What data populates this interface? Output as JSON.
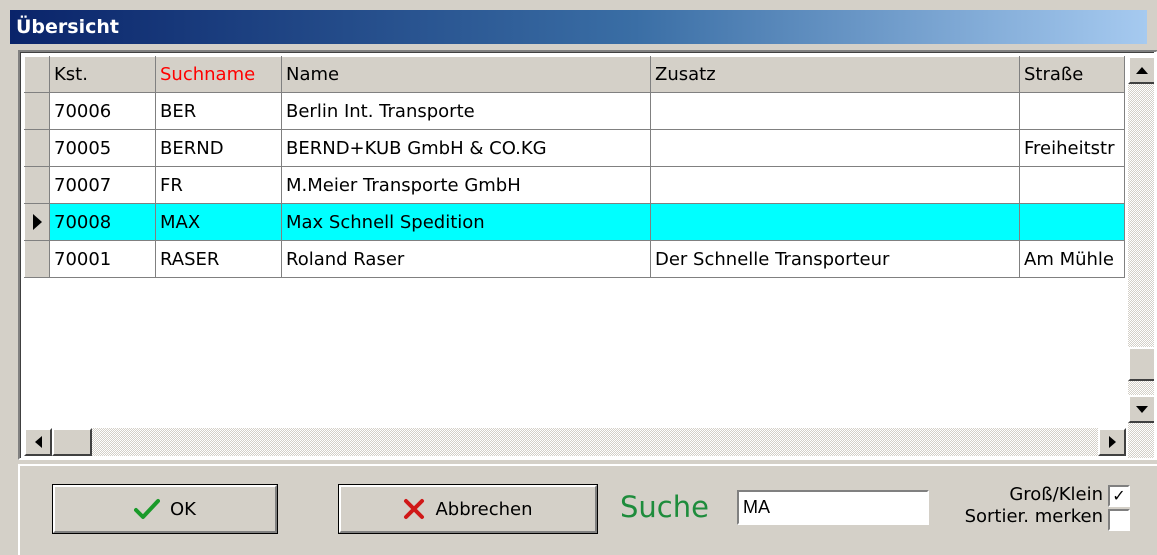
{
  "window": {
    "title": "Übersicht"
  },
  "grid": {
    "columns": [
      "Kst.",
      "Suchname",
      "Name",
      "Zusatz",
      "Straße"
    ],
    "sorted_column": "Suchname",
    "rows": [
      {
        "kst": "70006",
        "suchname": "BER",
        "name": "Berlin Int. Transporte",
        "zusatz": "",
        "strasse": "",
        "selected": false
      },
      {
        "kst": "70005",
        "suchname": "BERND",
        "name": "BERND+KUB GmbH & CO.KG",
        "zusatz": "",
        "strasse": "Freiheitstr",
        "selected": false
      },
      {
        "kst": "70007",
        "suchname": "FR",
        "name": "M.Meier Transporte GmbH",
        "zusatz": "",
        "strasse": "",
        "selected": false
      },
      {
        "kst": "70008",
        "suchname": "MAX",
        "name": "Max Schnell Spedition",
        "zusatz": "",
        "strasse": "",
        "selected": true
      },
      {
        "kst": "70001",
        "suchname": "RASER",
        "name": "Roland Raser",
        "zusatz": "Der Schnelle Transporteur",
        "strasse": "Am Mühle",
        "selected": false
      }
    ]
  },
  "buttons": {
    "ok_label": "OK",
    "cancel_label": "Abbrechen"
  },
  "search": {
    "label": "Suche",
    "value": "MA"
  },
  "options": {
    "case_label": "Groß/Klein",
    "case_checked": true,
    "remember_label": "Sortier. merken",
    "remember_checked": false
  },
  "colors": {
    "selection": "#00ffff",
    "sorted_header": "#ff0000",
    "search_label": "#1e8c3c"
  }
}
